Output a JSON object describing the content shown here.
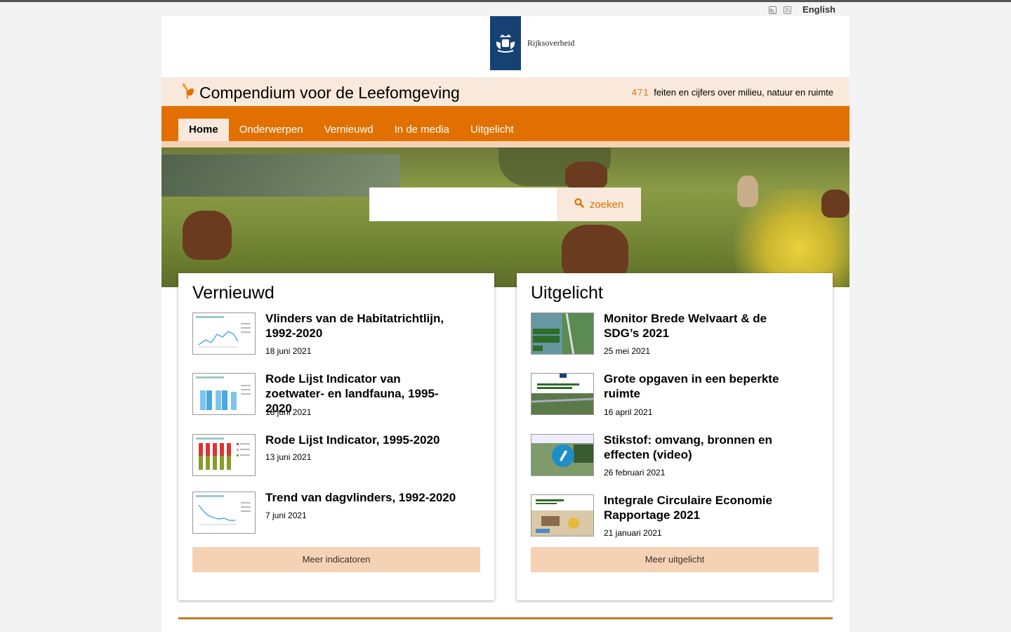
{
  "toplinks": {
    "twitter_icon": "twitter-icon",
    "rss_icon": "rss-icon",
    "language": "English"
  },
  "logo": {
    "text": "Rijksoverheid",
    "brand_color": "#154273"
  },
  "banner": {
    "title": "Compendium voor de Leefomgeving",
    "count": "471",
    "tagline": "feiten en cijfers over milieu, natuur en ruimte"
  },
  "nav": {
    "items": [
      "Home",
      "Onderwerpen",
      "Vernieuwd",
      "In de media",
      "Uitgelicht"
    ],
    "active": "Home"
  },
  "search": {
    "value": "",
    "placeholder": "",
    "button": "zoeken"
  },
  "vernieuwd": {
    "title": "Vernieuwd",
    "items": [
      {
        "title": "Vlinders van de Habitatrichtlijn, 1992-2020",
        "date": "18 juni 2021"
      },
      {
        "title": "Rode Lijst Indicator van zoetwater- en landfauna, 1995-2020",
        "date": "18 juni 2021"
      },
      {
        "title": "Rode Lijst Indicator, 1995-2020",
        "date": "13 juni 2021"
      },
      {
        "title": "Trend van dagvlinders, 1992-2020",
        "date": "7 juni 2021"
      }
    ],
    "more": "Meer indicatoren"
  },
  "uitgelicht": {
    "title": "Uitgelicht",
    "items": [
      {
        "title": "Monitor Brede Welvaart & de SDG’s 2021",
        "date": "25 mei 2021"
      },
      {
        "title": "Grote opgaven in een beperkte ruimte",
        "date": "16 april 2021"
      },
      {
        "title": "Stikstof: omvang, bronnen en effecten (video)",
        "date": "26 februari 2021"
      },
      {
        "title": "Integrale Circulaire Economie Rapportage 2021",
        "date": "21 januari 2021"
      }
    ],
    "more": "Meer uitgelicht"
  },
  "colors": {
    "accent": "#e17000",
    "banner_bg": "#f9e9dc",
    "button_bg": "#f6d2b4"
  }
}
